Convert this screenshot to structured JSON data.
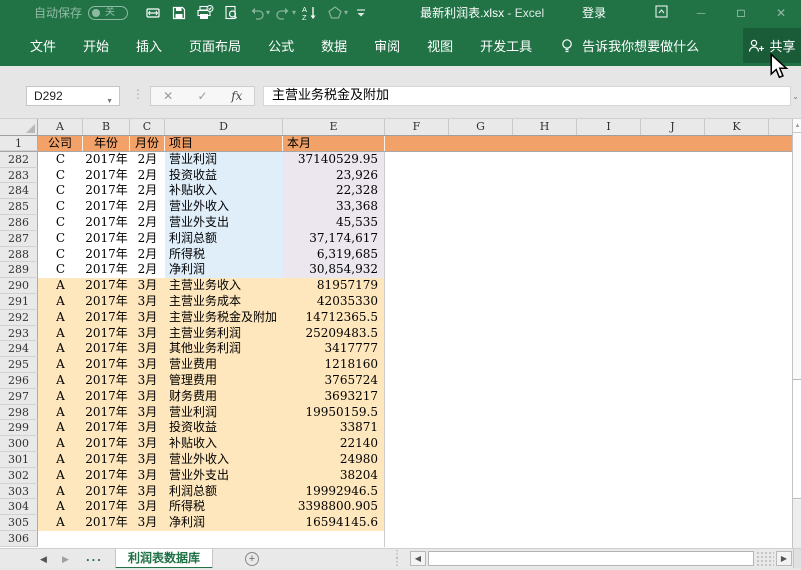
{
  "titlebar": {
    "autosave_label": "自动保存",
    "autosave_state": "关",
    "filename": "最新利润表.xlsx",
    "separator": "-",
    "app_name": "Excel",
    "signin": "登录"
  },
  "ribbon": {
    "tabs": [
      "文件",
      "开始",
      "插入",
      "页面布局",
      "公式",
      "数据",
      "审阅",
      "视图",
      "开发工具"
    ],
    "tellme": "告诉我你想要做什么",
    "share": "共享"
  },
  "formula_bar": {
    "name_box": "D292",
    "fx_label": "fx",
    "content": "主营业务税金及附加"
  },
  "colors": {
    "excel_green": "#217346",
    "share_button_green": "#1a5c38",
    "header_row_fill": "#f2a269",
    "blue_fill": "#e0eefa",
    "lavender_fill": "#ece7ee",
    "cream_fill": "#ffe7bd",
    "active_tab_green": "#1e7145"
  },
  "grid": {
    "columns": [
      "A",
      "B",
      "C",
      "D",
      "E",
      "F",
      "G",
      "H",
      "I",
      "J",
      "K"
    ],
    "header_row": {
      "n": "1",
      "cells": [
        "公司",
        "年份",
        "月份",
        "项目",
        "本月"
      ]
    },
    "rows": [
      {
        "n": "282",
        "group": "c",
        "company": "C",
        "year": "2017年",
        "month": "2月",
        "item": "营业利润",
        "value": "37140529.95"
      },
      {
        "n": "283",
        "group": "c",
        "company": "C",
        "year": "2017年",
        "month": "2月",
        "item": "投资收益",
        "value": "23,926"
      },
      {
        "n": "284",
        "group": "c",
        "company": "C",
        "year": "2017年",
        "month": "2月",
        "item": "补贴收入",
        "value": "22,328"
      },
      {
        "n": "285",
        "group": "c",
        "company": "C",
        "year": "2017年",
        "month": "2月",
        "item": "营业外收入",
        "value": "33,368"
      },
      {
        "n": "286",
        "group": "c",
        "company": "C",
        "year": "2017年",
        "month": "2月",
        "item": "营业外支出",
        "value": "45,535"
      },
      {
        "n": "287",
        "group": "c",
        "company": "C",
        "year": "2017年",
        "month": "2月",
        "item": "利润总额",
        "value": "37,174,617"
      },
      {
        "n": "288",
        "group": "c",
        "company": "C",
        "year": "2017年",
        "month": "2月",
        "item": "所得税",
        "value": "6,319,685"
      },
      {
        "n": "289",
        "group": "c",
        "company": "C",
        "year": "2017年",
        "month": "2月",
        "item": "净利润",
        "value": "30,854,932"
      },
      {
        "n": "290",
        "group": "a",
        "company": "A",
        "year": "2017年",
        "month": "3月",
        "item": "主营业务收入",
        "value": "81957179"
      },
      {
        "n": "291",
        "group": "a",
        "company": "A",
        "year": "2017年",
        "month": "3月",
        "item": "主营业务成本",
        "value": "42035330"
      },
      {
        "n": "292",
        "group": "a",
        "company": "A",
        "year": "2017年",
        "month": "3月",
        "item": "主营业务税金及附加",
        "value": "14712365.5"
      },
      {
        "n": "293",
        "group": "a",
        "company": "A",
        "year": "2017年",
        "month": "3月",
        "item": "主营业务利润",
        "value": "25209483.5"
      },
      {
        "n": "294",
        "group": "a",
        "company": "A",
        "year": "2017年",
        "month": "3月",
        "item": "其他业务利润",
        "value": "3417777"
      },
      {
        "n": "295",
        "group": "a",
        "company": "A",
        "year": "2017年",
        "month": "3月",
        "item": "营业费用",
        "value": "1218160"
      },
      {
        "n": "296",
        "group": "a",
        "company": "A",
        "year": "2017年",
        "month": "3月",
        "item": "管理费用",
        "value": "3765724"
      },
      {
        "n": "297",
        "group": "a",
        "company": "A",
        "year": "2017年",
        "month": "3月",
        "item": "财务费用",
        "value": "3693217"
      },
      {
        "n": "298",
        "group": "a",
        "company": "A",
        "year": "2017年",
        "month": "3月",
        "item": "营业利润",
        "value": "19950159.5"
      },
      {
        "n": "299",
        "group": "a",
        "company": "A",
        "year": "2017年",
        "month": "3月",
        "item": "投资收益",
        "value": "33871"
      },
      {
        "n": "300",
        "group": "a",
        "company": "A",
        "year": "2017年",
        "month": "3月",
        "item": "补贴收入",
        "value": "22140"
      },
      {
        "n": "301",
        "group": "a",
        "company": "A",
        "year": "2017年",
        "month": "3月",
        "item": "营业外收入",
        "value": "24980"
      },
      {
        "n": "302",
        "group": "a",
        "company": "A",
        "year": "2017年",
        "month": "3月",
        "item": "营业外支出",
        "value": "38204"
      },
      {
        "n": "303",
        "group": "a",
        "company": "A",
        "year": "2017年",
        "month": "3月",
        "item": "利润总额",
        "value": "19992946.5"
      },
      {
        "n": "304",
        "group": "a",
        "company": "A",
        "year": "2017年",
        "month": "3月",
        "item": "所得税",
        "value": "3398800.905"
      },
      {
        "n": "305",
        "group": "a",
        "company": "A",
        "year": "2017年",
        "month": "3月",
        "item": "净利润",
        "value": "16594145.6"
      },
      {
        "n": "306",
        "group": "",
        "company": "",
        "year": "",
        "month": "",
        "item": "",
        "value": ""
      }
    ]
  },
  "sheet_bar": {
    "tab": "利润表数据库"
  }
}
